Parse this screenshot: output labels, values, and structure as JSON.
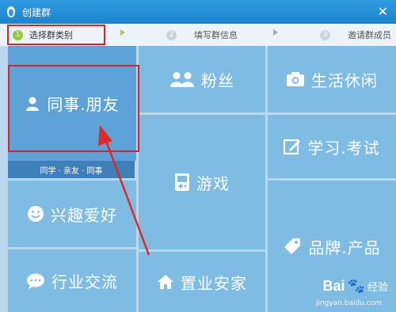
{
  "window": {
    "title": "创建群",
    "close_label": "✕"
  },
  "steps": [
    {
      "num": "1",
      "label": "选择群类别",
      "active": true
    },
    {
      "num": "2",
      "label": "填写群信息",
      "active": false
    },
    {
      "num": "3",
      "label": "邀请群成员",
      "active": false
    }
  ],
  "categories": {
    "colleague_friend": {
      "label": "同事.朋友",
      "sub": "同学 · 亲友 · 同事",
      "icon": "person-icon"
    },
    "interest": {
      "label": "兴趣爱好",
      "icon": "smiley-icon"
    },
    "industry": {
      "label": "行业交流",
      "icon": "chat-icon"
    },
    "fans": {
      "label": "粉丝",
      "icon": "people-icon"
    },
    "game": {
      "label": "游戏",
      "icon": "gamepad-icon"
    },
    "home": {
      "label": "置业安家",
      "icon": "house-icon"
    },
    "life": {
      "label": "生活休闲",
      "icon": "camera-icon"
    },
    "study": {
      "label": "学习.考试",
      "icon": "edit-icon"
    },
    "brand": {
      "label": "品牌.产品",
      "icon": "tag-icon"
    }
  },
  "watermark": {
    "text": "Bai",
    "suffix": "经验",
    "url": "jingyan.baidu.com"
  },
  "colors": {
    "tile": "#7fbce3",
    "selected": "#5ea3d7",
    "highlight": "#d9232b",
    "titlebar": "#1b84cf"
  }
}
